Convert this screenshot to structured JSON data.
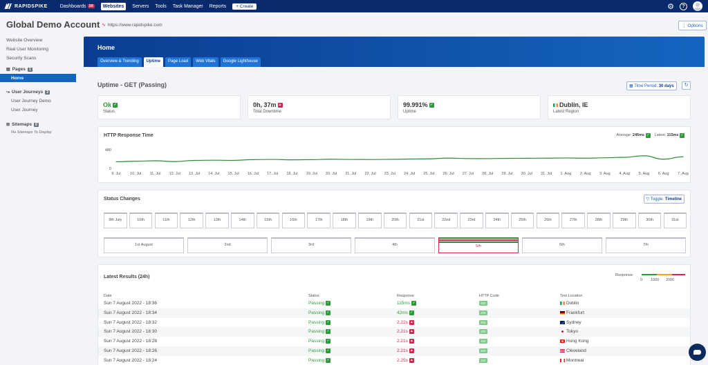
{
  "nav": {
    "logo": "RAPIDSPIKE",
    "items": [
      {
        "label": "Dashboards",
        "badge": "10"
      },
      {
        "label": "Websites",
        "active": true
      },
      {
        "label": "Servers"
      },
      {
        "label": "Tools"
      },
      {
        "label": "Task Manager"
      },
      {
        "label": "Reports"
      }
    ],
    "create_label": "+ Create"
  },
  "header": {
    "title": "Global Demo Account",
    "url": "https://www.rapidspike.com",
    "options_label": "Options"
  },
  "sidebar": {
    "links": [
      "Website Overview",
      "Real User Monitoring",
      "Security Scans"
    ],
    "pages_label": "Pages",
    "pages_count": "1",
    "pages_active": "Home",
    "journeys_label": "User Journeys",
    "journeys_count": "2",
    "journeys": [
      "User Journey Demo",
      "User Journey"
    ],
    "sitemaps_label": "Sitemaps",
    "sitemaps_count": "0",
    "sitemaps_empty": "No Sitemaps To Display"
  },
  "banner": {
    "title": "Home",
    "tabs": [
      "Overview & Trending",
      "Uptime",
      "Page Load",
      "Web Vitals",
      "Google Lighthouse"
    ],
    "active_tab": "Uptime"
  },
  "uptime": {
    "title": "Uptime - GET (Passing)",
    "time_period_label": "Time Period:",
    "time_period_value": "30 days",
    "stats": [
      {
        "value": "Ok",
        "label": "Status",
        "icon": "check-icon",
        "color": "#2e9b3b"
      },
      {
        "value": "0h, 37m",
        "label": "Total Downtime",
        "icon": "warning-icon"
      },
      {
        "value": "99.991%",
        "label": "Uptime",
        "icon": "check-icon"
      },
      {
        "value": "Dublin, IE",
        "label": "Latest Region",
        "icon": "flag-ie-icon"
      }
    ]
  },
  "http_chart": {
    "title": "HTTP Response Time",
    "average_label": "Average:",
    "average_value": "246ms",
    "latest_label": "Latest:",
    "latest_value": "115ms"
  },
  "chart_data": {
    "type": "line",
    "title": "HTTP Response Time",
    "ylim": [
      0,
      480
    ],
    "yticks": [
      "480",
      "0"
    ],
    "x": [
      "9. Jul",
      "10. Jul",
      "11. Jul",
      "12. Jul",
      "13. Jul",
      "14. Jul",
      "15. Jul",
      "16. Jul",
      "17. Jul",
      "18. Jul",
      "19. Jul",
      "20. Jul",
      "21. Jul",
      "22. Jul",
      "23. Jul",
      "24. Jul",
      "25. Jul",
      "26. Jul",
      "27. Jul",
      "28. Jul",
      "29. Jul",
      "30. Jul",
      "31. Jul",
      "1. Aug",
      "2. Aug",
      "3. Aug",
      "4. Aug",
      "5. Aug",
      "6. Aug",
      "7. Aug"
    ],
    "series": [
      {
        "values": [
          170,
          185,
          195,
          175,
          205,
          210,
          205,
          225,
          230,
          220,
          225,
          235,
          230,
          228,
          232,
          240,
          245,
          265,
          252,
          250,
          258,
          260,
          262,
          268,
          262,
          272,
          285,
          325,
          235,
          300
        ],
        "color": "#2e8b3b"
      }
    ]
  },
  "status_changes": {
    "title": "Status Changes",
    "toggle_label": "Toggle:",
    "toggle_value": "Timeline",
    "july_days": [
      "9th July",
      "10th",
      "11th",
      "12th",
      "13th",
      "14th",
      "15th",
      "16th",
      "17th",
      "18th",
      "19th",
      "20th",
      "21st",
      "22nd",
      "23rd",
      "24th",
      "25th",
      "26th",
      "27th",
      "28th",
      "29th",
      "30th",
      "31st"
    ],
    "aug_days": [
      "1st August",
      "2nd",
      "3rd",
      "4th",
      "5th",
      "6th",
      "7th"
    ],
    "selected": "5th"
  },
  "results": {
    "title": "Latest Results (24h)",
    "legend_label": "Response:",
    "legend_ticks": [
      "0",
      "1000",
      "2000"
    ],
    "columns": [
      "Date",
      "Status",
      "Response",
      "HTTP Code",
      "Test Location"
    ],
    "rows": [
      {
        "date": "Sun 7 August 2022 - 18:36",
        "status": "Passing",
        "response": "115ms",
        "ok": true,
        "code": "200",
        "location": "Dublin",
        "flag": "ie"
      },
      {
        "date": "Sun 7 August 2022 - 18:34",
        "status": "Passing",
        "response": "42ms",
        "ok": true,
        "code": "200",
        "location": "Frankfurt",
        "flag": "de"
      },
      {
        "date": "Sun 7 August 2022 - 18:32",
        "status": "Passing",
        "response": "2.22s",
        "ok": false,
        "code": "200",
        "location": "Sydney",
        "flag": "au"
      },
      {
        "date": "Sun 7 August 2022 - 18:30",
        "status": "Passing",
        "response": "2.21s",
        "ok": false,
        "code": "200",
        "location": "Tokyo",
        "flag": "jp"
      },
      {
        "date": "Sun 7 August 2022 - 18:28",
        "status": "Passing",
        "response": "2.21s",
        "ok": false,
        "code": "200",
        "location": "Hong Kong",
        "flag": "hk"
      },
      {
        "date": "Sun 7 August 2022 - 18:26",
        "status": "Passing",
        "response": "2.21s",
        "ok": false,
        "code": "200",
        "location": "Cleveland",
        "flag": "us"
      },
      {
        "date": "Sun 7 August 2022 - 18:24",
        "status": "Passing",
        "response": "2.25s",
        "ok": false,
        "code": "200",
        "location": "Montreal",
        "flag": "ca"
      }
    ]
  }
}
